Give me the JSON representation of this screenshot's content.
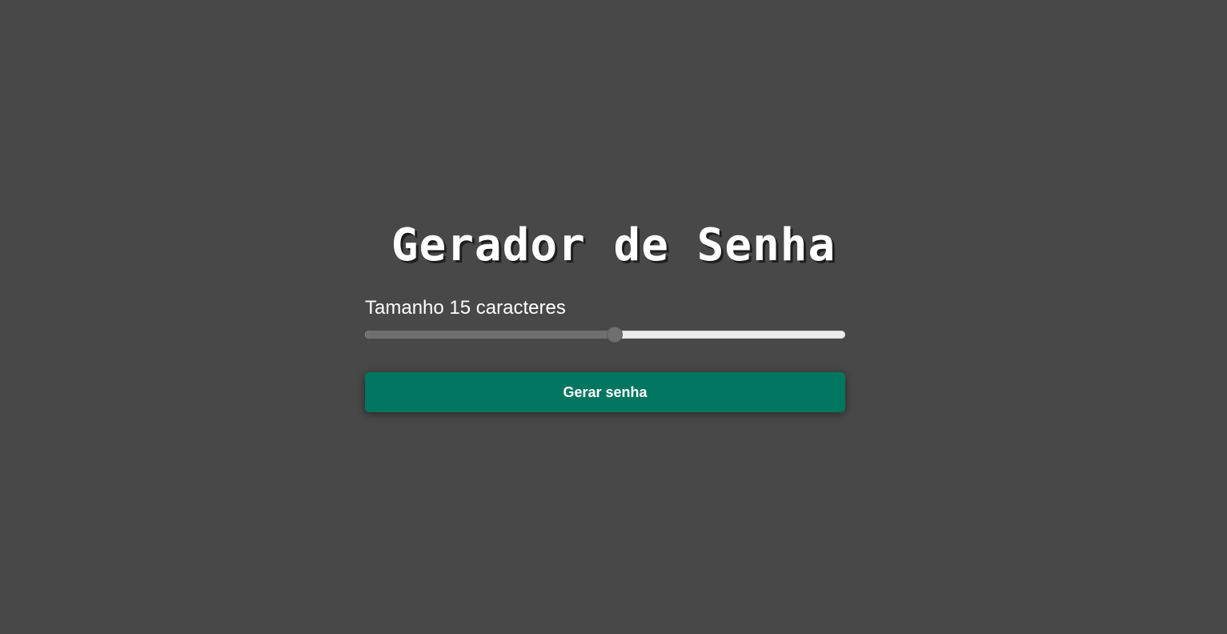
{
  "header": {
    "title": "Gerador de Senha"
  },
  "size_control": {
    "label_prefix": "Tamanho",
    "value": 15,
    "label_suffix": "caracteres",
    "slider_fraction": 0.52
  },
  "actions": {
    "generate_label": "Gerar senha"
  },
  "colors": {
    "background": "#484848",
    "button": "#007560",
    "slider_fill": "#6f6f6f",
    "slider_track": "#ececec",
    "text": "#ffffff"
  }
}
